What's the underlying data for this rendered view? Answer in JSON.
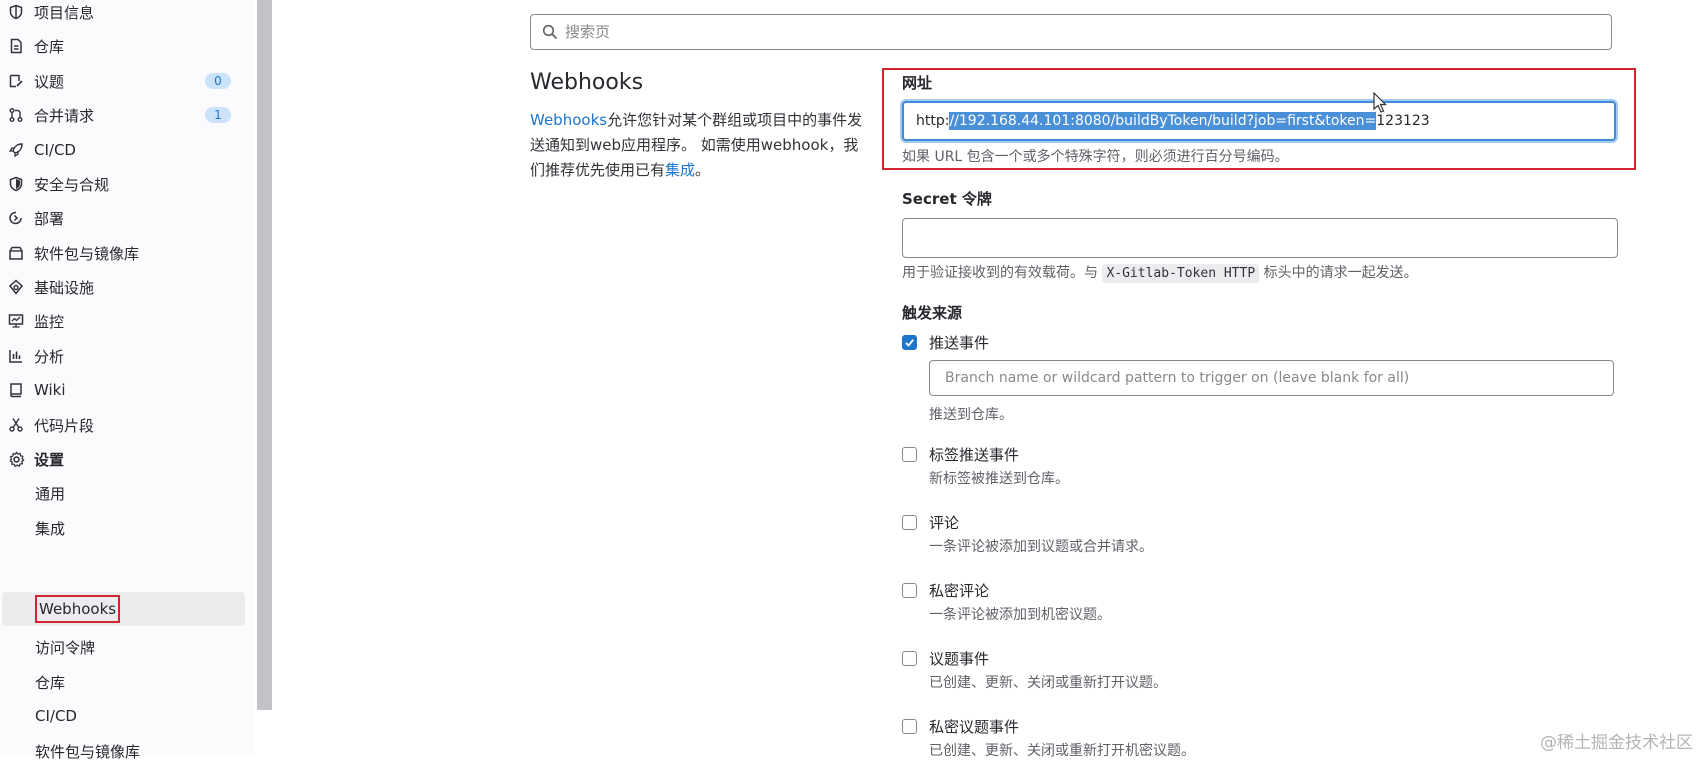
{
  "sidebar": {
    "nav": [
      {
        "label": "项目信息",
        "icon": "project-info-icon",
        "badge": null
      },
      {
        "label": "仓库",
        "icon": "document-icon",
        "badge": null
      },
      {
        "label": "议题",
        "icon": "issues-icon",
        "badge": "0"
      },
      {
        "label": "合并请求",
        "icon": "merge-request-icon",
        "badge": "1"
      },
      {
        "label": "CI/CD",
        "icon": "rocket-icon",
        "badge": null
      },
      {
        "label": "安全与合规",
        "icon": "shield-icon",
        "badge": null
      },
      {
        "label": "部署",
        "icon": "deploy-icon",
        "badge": null
      },
      {
        "label": "软件包与镜像库",
        "icon": "package-icon",
        "badge": null
      },
      {
        "label": "基础设施",
        "icon": "cloud-gear-icon",
        "badge": null
      },
      {
        "label": "监控",
        "icon": "monitor-icon",
        "badge": null
      },
      {
        "label": "分析",
        "icon": "chart-icon",
        "badge": null
      },
      {
        "label": "Wiki",
        "icon": "book-icon",
        "badge": null
      },
      {
        "label": "代码片段",
        "icon": "scissors-icon",
        "badge": null
      },
      {
        "label": "设置",
        "icon": "gear-icon",
        "badge": null
      }
    ],
    "settings_sub": [
      {
        "label": "通用"
      },
      {
        "label": "集成"
      },
      {
        "label": "Webhooks"
      },
      {
        "label": "访问令牌"
      },
      {
        "label": "仓库"
      },
      {
        "label": "CI/CD"
      },
      {
        "label": "软件包与镜像库"
      }
    ]
  },
  "search": {
    "placeholder": "搜索页"
  },
  "section": {
    "title": "Webhooks",
    "desc_link": "Webhooks",
    "desc_text1": "允许您针对某个群组或项目中的事件发送通知到web应用程序。 如需使用webhook，我们推荐优先使用已有",
    "desc_link2": "集成",
    "desc_text2": "。"
  },
  "url_field": {
    "label": "网址",
    "value_prefix": "http:",
    "value_selected": "//192.168.44.101:8080/buildByToken/build?job=first&token=",
    "value_suffix": "123123",
    "help": "如果 URL 包含一个或多个特殊字符，则必须进行百分号编码。"
  },
  "secret_field": {
    "label": "Secret 令牌",
    "value": "",
    "help_before": "用于验证接收到的有效载荷。与",
    "help_code": "X-Gitlab-Token HTTP",
    "help_after": "标头中的请求一起发送。"
  },
  "triggers": {
    "title": "触发来源",
    "branch_placeholder": "Branch name or wildcard pattern to trigger on (leave blank for all)",
    "items": [
      {
        "label": "推送事件",
        "desc": "推送到仓库。",
        "checked": true
      },
      {
        "label": "标签推送事件",
        "desc": "新标签被推送到仓库。",
        "checked": false
      },
      {
        "label": "评论",
        "desc": "一条评论被添加到议题或合并请求。",
        "checked": false
      },
      {
        "label": "私密评论",
        "desc": "一条评论被添加到机密议题。",
        "checked": false
      },
      {
        "label": "议题事件",
        "desc": "已创建、更新、关闭或重新打开议题。",
        "checked": false
      },
      {
        "label": "私密议题事件",
        "desc": "已创建、更新、关闭或重新打开机密议题。",
        "checked": false
      }
    ]
  },
  "watermark": "@稀土掘金技术社区",
  "colors": {
    "accent": "#1f75cb",
    "highlight_border": "#d3242f",
    "selection": "#4a90d9"
  }
}
